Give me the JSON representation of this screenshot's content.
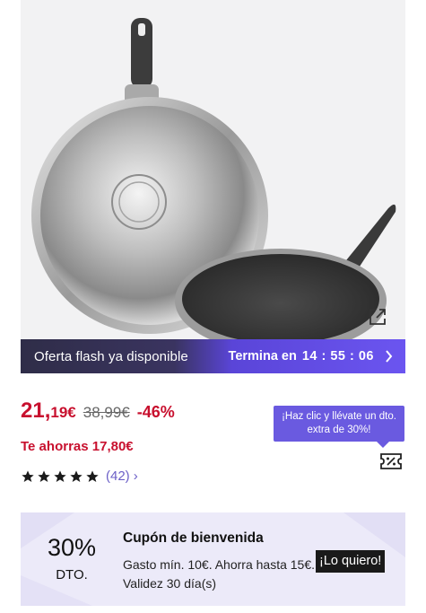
{
  "flash_bar": {
    "label": "Oferta flash ya disponible",
    "ends_label": "Termina en",
    "timer": "14 : 55 : 06"
  },
  "price": {
    "integer": "21,",
    "decimal": "19€",
    "original": "38,99€",
    "discount": "-46%"
  },
  "savings": "Te ahorras 17,80€",
  "rating": {
    "stars": 5,
    "count": "(42)",
    "chevron": "›"
  },
  "tooltip": "¡Haz clic y llévate un dto. extra de 30%!",
  "welcome": {
    "percent": "30%",
    "dto_label": "DTO.",
    "title": "Cupón de bienvenida",
    "description": "Gasto mín. 10€. Ahorra hasta 15€. Validez 30 día(s)",
    "button": "¡Lo quiero!"
  },
  "icons": {
    "external": "external-link-icon",
    "chevron": "chevron-right-icon",
    "star": "star-icon",
    "coupon": "coupon-icon"
  },
  "colors": {
    "price_red": "#c8102e",
    "accent_purple": "#6a5ae0",
    "review_purple": "#6b5fc7"
  }
}
